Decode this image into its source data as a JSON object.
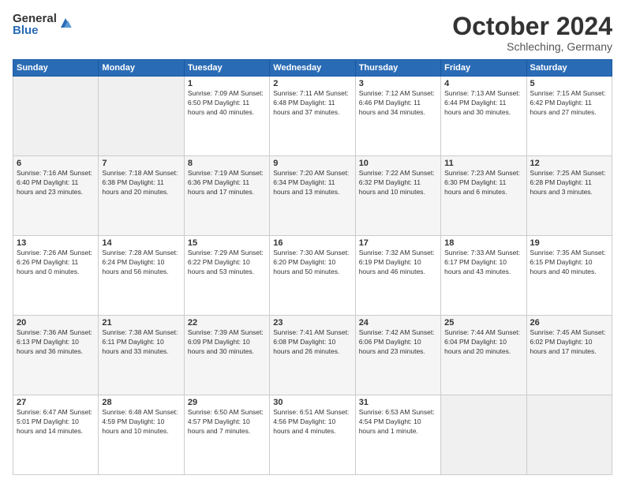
{
  "logo": {
    "general": "General",
    "blue": "Blue"
  },
  "calendar": {
    "title": "October 2024",
    "location": "Schleching, Germany",
    "days": [
      "Sunday",
      "Monday",
      "Tuesday",
      "Wednesday",
      "Thursday",
      "Friday",
      "Saturday"
    ],
    "weeks": [
      [
        {
          "day": "",
          "info": ""
        },
        {
          "day": "",
          "info": ""
        },
        {
          "day": "1",
          "info": "Sunrise: 7:09 AM\nSunset: 6:50 PM\nDaylight: 11 hours and 40 minutes."
        },
        {
          "day": "2",
          "info": "Sunrise: 7:11 AM\nSunset: 6:48 PM\nDaylight: 11 hours and 37 minutes."
        },
        {
          "day": "3",
          "info": "Sunrise: 7:12 AM\nSunset: 6:46 PM\nDaylight: 11 hours and 34 minutes."
        },
        {
          "day": "4",
          "info": "Sunrise: 7:13 AM\nSunset: 6:44 PM\nDaylight: 11 hours and 30 minutes."
        },
        {
          "day": "5",
          "info": "Sunrise: 7:15 AM\nSunset: 6:42 PM\nDaylight: 11 hours and 27 minutes."
        }
      ],
      [
        {
          "day": "6",
          "info": "Sunrise: 7:16 AM\nSunset: 6:40 PM\nDaylight: 11 hours and 23 minutes."
        },
        {
          "day": "7",
          "info": "Sunrise: 7:18 AM\nSunset: 6:38 PM\nDaylight: 11 hours and 20 minutes."
        },
        {
          "day": "8",
          "info": "Sunrise: 7:19 AM\nSunset: 6:36 PM\nDaylight: 11 hours and 17 minutes."
        },
        {
          "day": "9",
          "info": "Sunrise: 7:20 AM\nSunset: 6:34 PM\nDaylight: 11 hours and 13 minutes."
        },
        {
          "day": "10",
          "info": "Sunrise: 7:22 AM\nSunset: 6:32 PM\nDaylight: 11 hours and 10 minutes."
        },
        {
          "day": "11",
          "info": "Sunrise: 7:23 AM\nSunset: 6:30 PM\nDaylight: 11 hours and 6 minutes."
        },
        {
          "day": "12",
          "info": "Sunrise: 7:25 AM\nSunset: 6:28 PM\nDaylight: 11 hours and 3 minutes."
        }
      ],
      [
        {
          "day": "13",
          "info": "Sunrise: 7:26 AM\nSunset: 6:26 PM\nDaylight: 11 hours and 0 minutes."
        },
        {
          "day": "14",
          "info": "Sunrise: 7:28 AM\nSunset: 6:24 PM\nDaylight: 10 hours and 56 minutes."
        },
        {
          "day": "15",
          "info": "Sunrise: 7:29 AM\nSunset: 6:22 PM\nDaylight: 10 hours and 53 minutes."
        },
        {
          "day": "16",
          "info": "Sunrise: 7:30 AM\nSunset: 6:20 PM\nDaylight: 10 hours and 50 minutes."
        },
        {
          "day": "17",
          "info": "Sunrise: 7:32 AM\nSunset: 6:19 PM\nDaylight: 10 hours and 46 minutes."
        },
        {
          "day": "18",
          "info": "Sunrise: 7:33 AM\nSunset: 6:17 PM\nDaylight: 10 hours and 43 minutes."
        },
        {
          "day": "19",
          "info": "Sunrise: 7:35 AM\nSunset: 6:15 PM\nDaylight: 10 hours and 40 minutes."
        }
      ],
      [
        {
          "day": "20",
          "info": "Sunrise: 7:36 AM\nSunset: 6:13 PM\nDaylight: 10 hours and 36 minutes."
        },
        {
          "day": "21",
          "info": "Sunrise: 7:38 AM\nSunset: 6:11 PM\nDaylight: 10 hours and 33 minutes."
        },
        {
          "day": "22",
          "info": "Sunrise: 7:39 AM\nSunset: 6:09 PM\nDaylight: 10 hours and 30 minutes."
        },
        {
          "day": "23",
          "info": "Sunrise: 7:41 AM\nSunset: 6:08 PM\nDaylight: 10 hours and 26 minutes."
        },
        {
          "day": "24",
          "info": "Sunrise: 7:42 AM\nSunset: 6:06 PM\nDaylight: 10 hours and 23 minutes."
        },
        {
          "day": "25",
          "info": "Sunrise: 7:44 AM\nSunset: 6:04 PM\nDaylight: 10 hours and 20 minutes."
        },
        {
          "day": "26",
          "info": "Sunrise: 7:45 AM\nSunset: 6:02 PM\nDaylight: 10 hours and 17 minutes."
        }
      ],
      [
        {
          "day": "27",
          "info": "Sunrise: 6:47 AM\nSunset: 5:01 PM\nDaylight: 10 hours and 14 minutes."
        },
        {
          "day": "28",
          "info": "Sunrise: 6:48 AM\nSunset: 4:59 PM\nDaylight: 10 hours and 10 minutes."
        },
        {
          "day": "29",
          "info": "Sunrise: 6:50 AM\nSunset: 4:57 PM\nDaylight: 10 hours and 7 minutes."
        },
        {
          "day": "30",
          "info": "Sunrise: 6:51 AM\nSunset: 4:56 PM\nDaylight: 10 hours and 4 minutes."
        },
        {
          "day": "31",
          "info": "Sunrise: 6:53 AM\nSunset: 4:54 PM\nDaylight: 10 hours and 1 minute."
        },
        {
          "day": "",
          "info": ""
        },
        {
          "day": "",
          "info": ""
        }
      ]
    ]
  }
}
